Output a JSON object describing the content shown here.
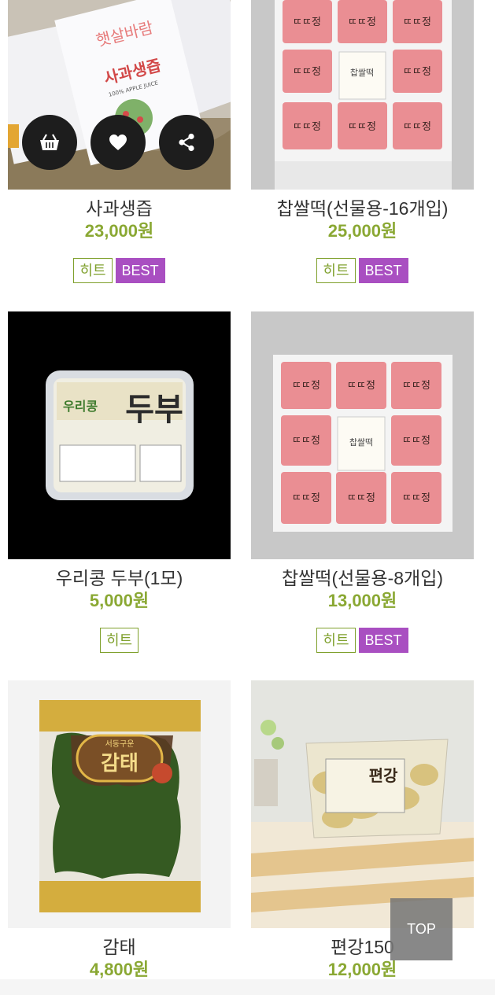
{
  "products": [
    {
      "name": "사과생즙",
      "price": "23,000원",
      "badges": {
        "hit": "히트",
        "best": "BEST"
      },
      "image_labels": {
        "brand": "햇살바람",
        "title": "사과생즙",
        "sub": "100% APPLE JUICE"
      }
    },
    {
      "name": "찹쌀떡(선물용-16개입)",
      "price": "25,000원",
      "badges": {
        "hit": "히트",
        "best": "BEST"
      },
      "image_labels": {
        "center": "찹쌀떡",
        "piece": "ㄸㄸ정"
      }
    },
    {
      "name": "우리콩 두부(1모)",
      "price": "5,000원",
      "badges": {
        "hit": "히트"
      },
      "image_labels": {
        "brand": "우리콩",
        "title": "두부"
      }
    },
    {
      "name": "찹쌀떡(선물용-8개입)",
      "price": "13,000원",
      "badges": {
        "hit": "히트",
        "best": "BEST"
      },
      "image_labels": {
        "center": "찹쌀떡",
        "piece": "ㄸㄸ정"
      }
    },
    {
      "name": "감태",
      "price": "4,800원",
      "image_labels": {
        "brand": "서동구운",
        "title": "감태"
      }
    },
    {
      "name": "편강150",
      "price": "12,000원",
      "image_labels": {
        "title": "편강"
      }
    }
  ],
  "actions": {
    "cart_icon": "shopping-basket-icon",
    "wishlist_icon": "heart-icon",
    "share_icon": "share-icon"
  },
  "top_button": "TOP",
  "colors": {
    "price": "#8aa833",
    "hit_badge": "#7fa02c",
    "best_badge": "#a94fc1",
    "action_button": "#1d1d1d"
  }
}
